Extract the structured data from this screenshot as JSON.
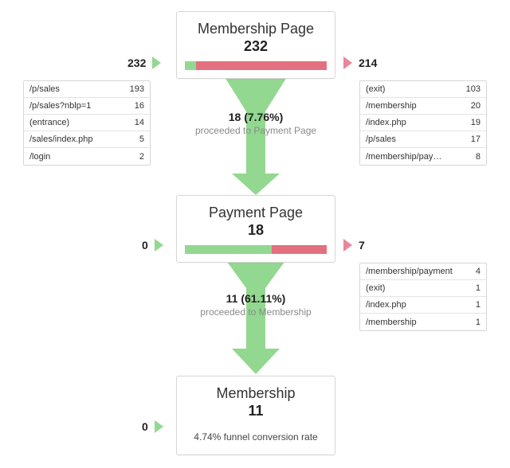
{
  "colors": {
    "green": "#93d890",
    "red": "#e3707f",
    "triangle_green": "#93d890",
    "triangle_red": "#e8879a",
    "border": "#d6d6d6",
    "muted_text": "#8a8a8a"
  },
  "steps": [
    {
      "title": "Membership Page",
      "count": "232",
      "entries_number": "232",
      "exits_number": "214",
      "bar_green_percent": 7.76,
      "bar_red_percent": 92.24,
      "entry_sources": [
        {
          "label": "/p/sales",
          "value": "193"
        },
        {
          "label": "/p/sales?nblp=1",
          "value": "16"
        },
        {
          "label": "(entrance)",
          "value": "14"
        },
        {
          "label": "/sales/index.php",
          "value": "5"
        },
        {
          "label": "/login",
          "value": "2"
        }
      ],
      "exit_destinations": [
        {
          "label": "(exit)",
          "value": "103"
        },
        {
          "label": "/membership",
          "value": "20"
        },
        {
          "label": "/index.php",
          "value": "19"
        },
        {
          "label": "/p/sales",
          "value": "17"
        },
        {
          "label": "/membership/pay…",
          "value": "8"
        }
      ]
    },
    {
      "title": "Payment Page",
      "count": "18",
      "entries_number": "0",
      "exits_number": "7",
      "bar_green_percent": 61.11,
      "bar_red_percent": 38.89,
      "entry_sources": [],
      "exit_destinations": [
        {
          "label": "/membership/payment",
          "value": "4"
        },
        {
          "label": "(exit)",
          "value": "1"
        },
        {
          "label": "/index.php",
          "value": "1"
        },
        {
          "label": "/membership",
          "value": "1"
        }
      ]
    },
    {
      "title": "Membership",
      "count": "11",
      "entries_number": "0",
      "note": "4.74% funnel conversion rate"
    }
  ],
  "connectors": [
    {
      "main": "18 (7.76%)",
      "sub": "proceeded to Payment Page"
    },
    {
      "main": "11 (61.11%)",
      "sub": "proceeded to Membership"
    }
  ]
}
